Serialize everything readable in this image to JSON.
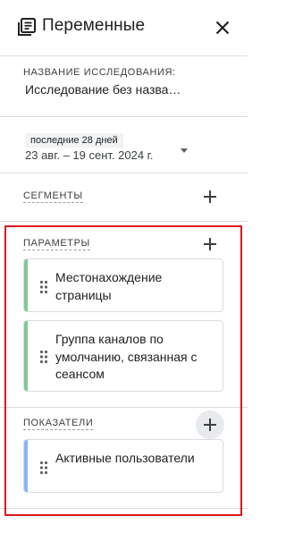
{
  "header": {
    "title": "Переменные",
    "icon": "explorations-icon",
    "close_icon": "close-icon"
  },
  "study": {
    "label": "НАЗВАНИЕ ИССЛЕДОВАНИЯ:",
    "name": "Исследование без назва…"
  },
  "date": {
    "chip": "последние 28 дней",
    "range": "23 авг. – 19 сент. 2024 г."
  },
  "segments": {
    "label": "СЕГМЕНТЫ"
  },
  "dimensions": {
    "label": "ПАРАМЕТРЫ",
    "items": [
      {
        "text": "Местонахождение страницы"
      },
      {
        "text": "Группа каналов по умолчанию, связанная с сеансом"
      }
    ],
    "accent": "#81c995"
  },
  "metrics": {
    "label": "ПОКАЗАТЕЛИ",
    "items": [
      {
        "text": "Активные пользователи"
      }
    ],
    "accent": "#8ab4f8"
  },
  "colors": {
    "highlight": "#e0121b",
    "divider": "#dadce0",
    "text": "#202124"
  }
}
